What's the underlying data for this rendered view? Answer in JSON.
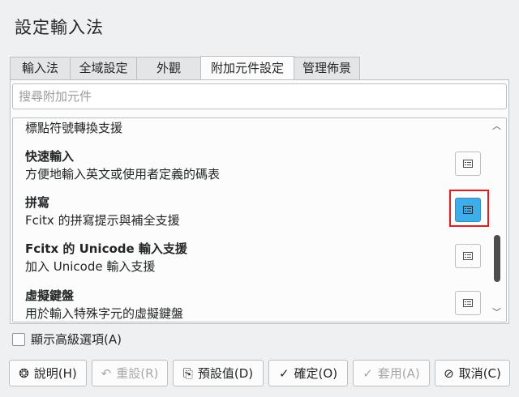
{
  "window": {
    "title": "設定輸入法"
  },
  "tabs": [
    {
      "label": "輸入法"
    },
    {
      "label": "全域設定"
    },
    {
      "label": "外觀"
    },
    {
      "label": "附加元件設定",
      "active": true
    },
    {
      "label": "管理佈景"
    }
  ],
  "search": {
    "placeholder": "搜尋附加元件"
  },
  "addons": [
    {
      "desc": "標點符號轉換支援"
    },
    {
      "title": "快速輸入",
      "desc": "方便地輸入英文或使用者定義的碼表"
    },
    {
      "title": "拼寫",
      "desc": "Fcitx 的拼寫提示與補全支援",
      "highlighted": true
    },
    {
      "title": "Fcitx 的 Unicode 輸入支援",
      "desc": "加入 Unicode 輸入支援"
    },
    {
      "title": "虛擬鍵盤",
      "desc": "用於輸入特殊字元的虛擬鍵盤"
    }
  ],
  "advanced": {
    "label": "顯示高級選項(A)",
    "checked": false
  },
  "buttons": {
    "help": "說明(H)",
    "reset": "重設(R)",
    "defaults": "預設值(D)",
    "ok": "確定(O)",
    "apply": "套用(A)",
    "cancel": "取消(C)"
  },
  "icons": {
    "configure": "configure-icon",
    "scroll_up": "chevron-up-icon",
    "scroll_down": "chevron-down-icon"
  },
  "colors": {
    "accent": "#3daee9",
    "highlight_border": "#e81c1c",
    "background": "#eff0f1"
  }
}
